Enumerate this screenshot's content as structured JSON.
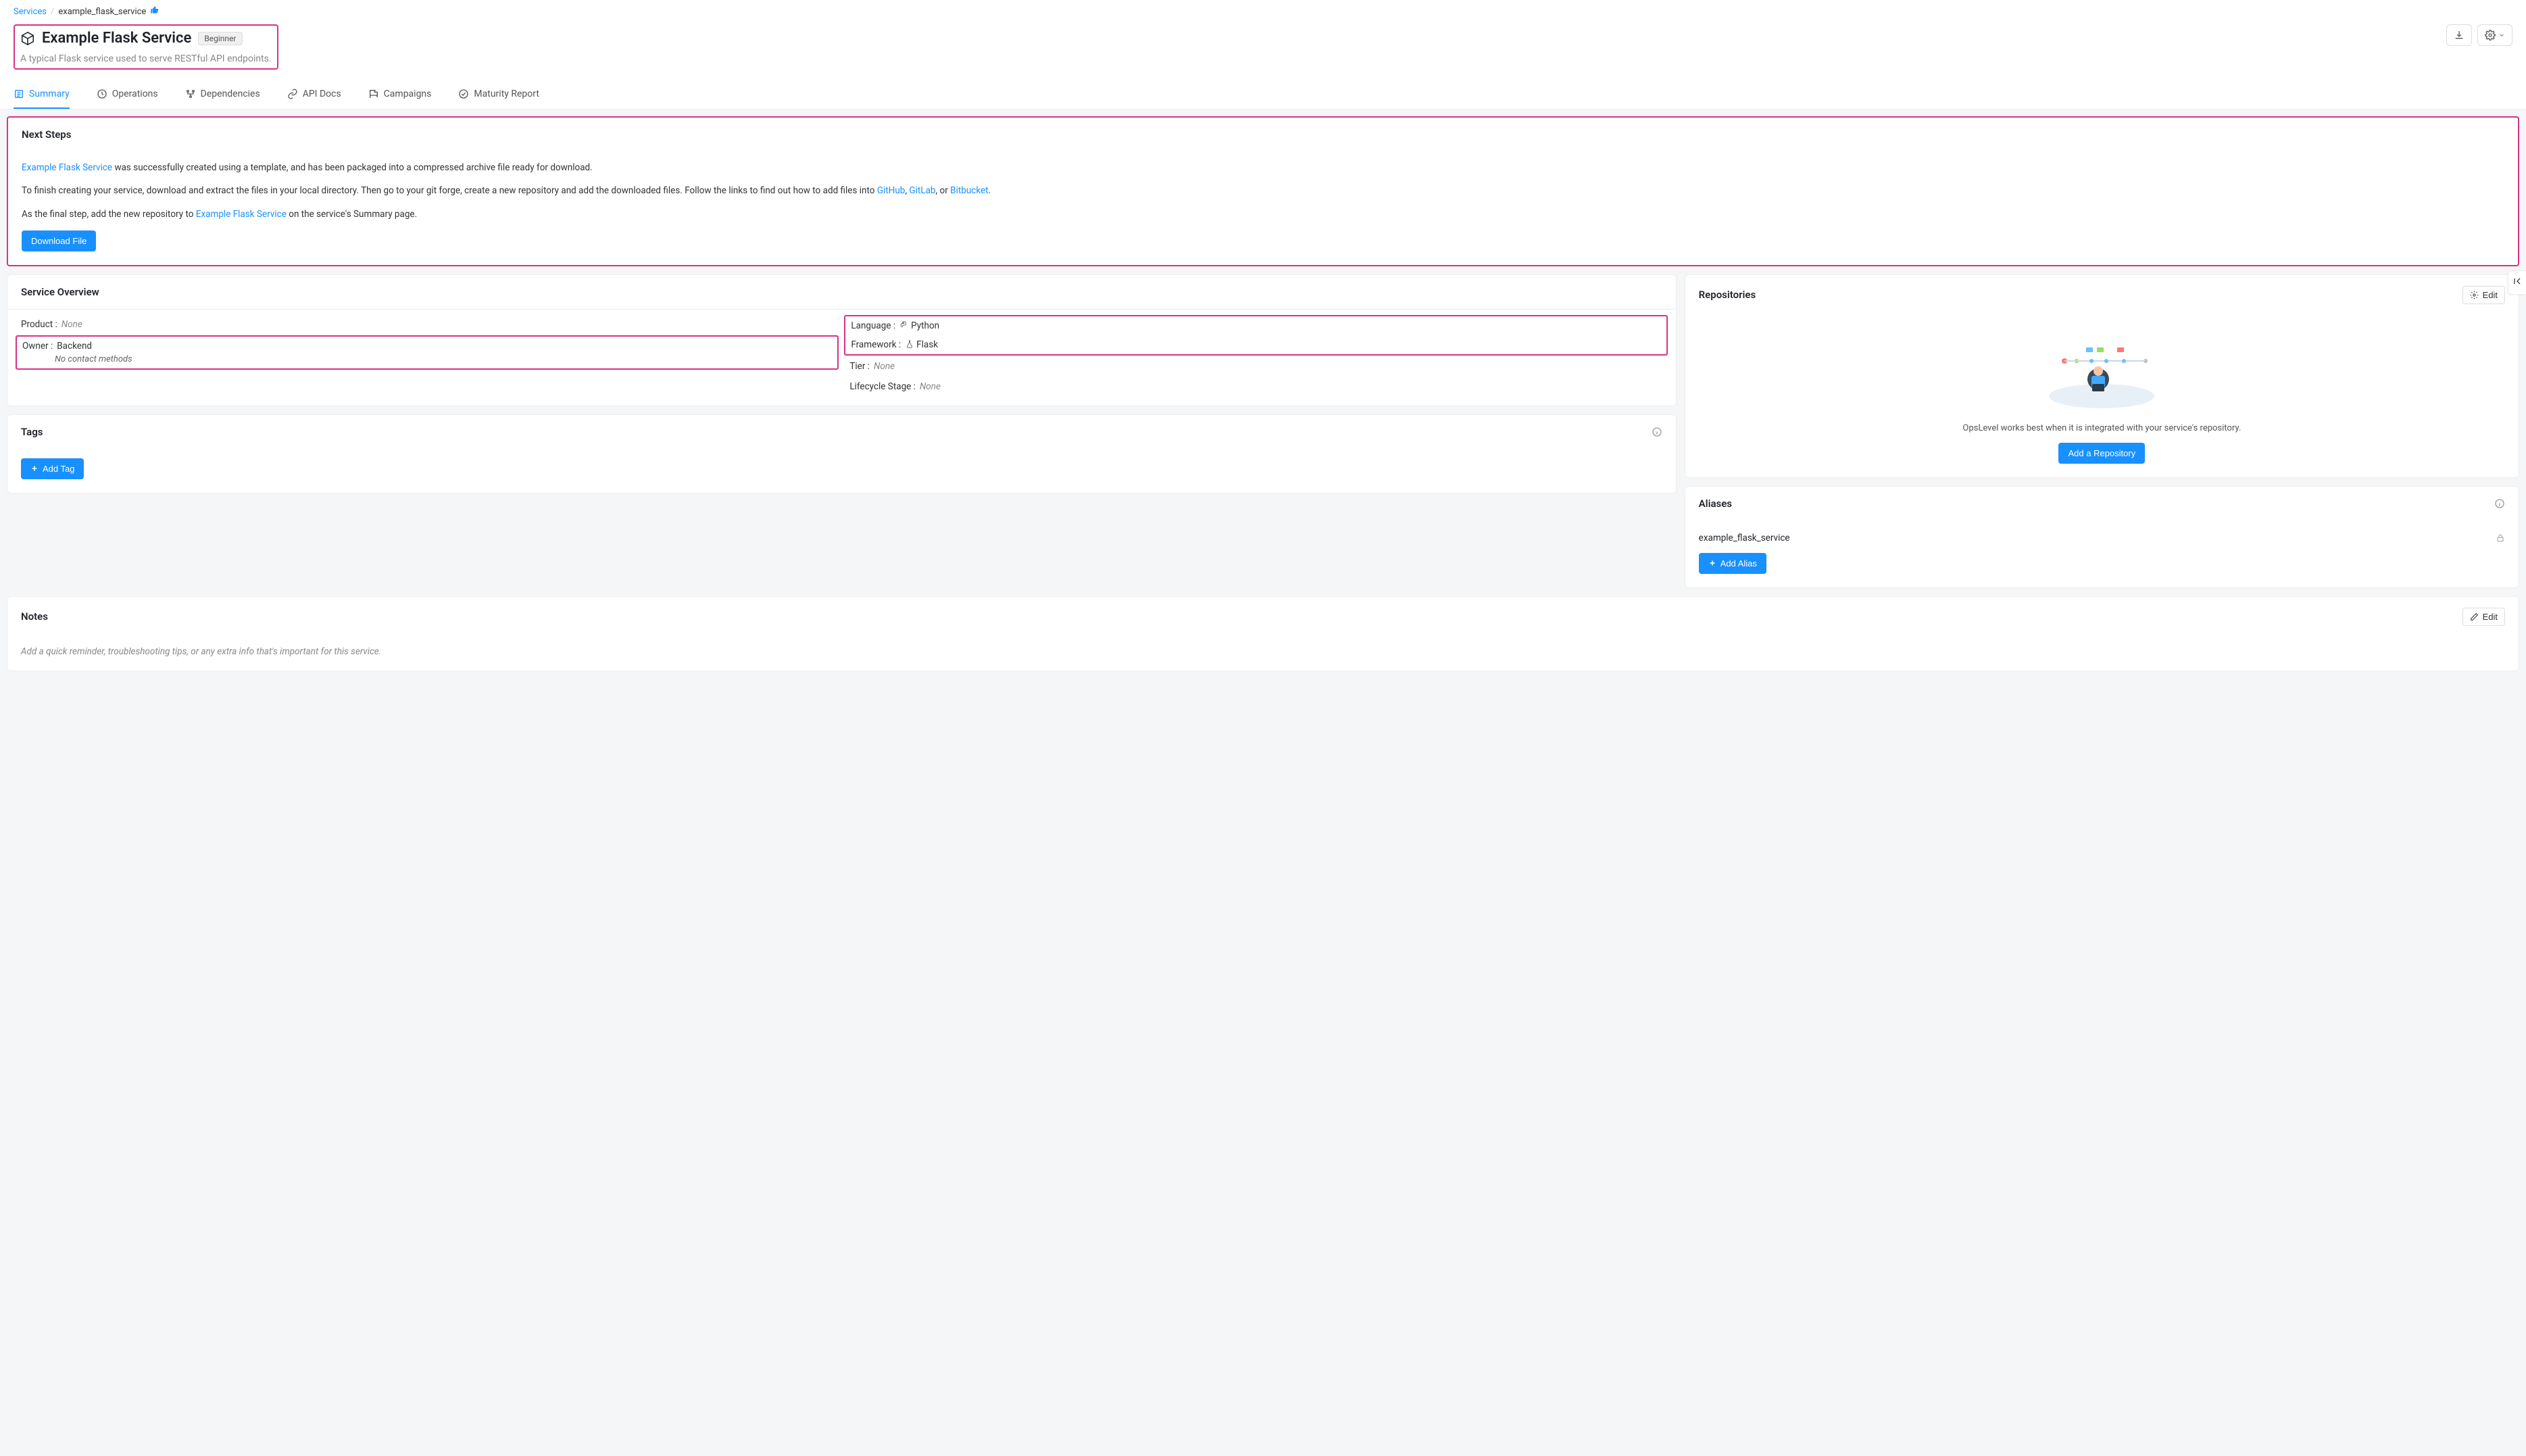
{
  "breadcrumb": {
    "root": "Services",
    "current": "example_flask_service"
  },
  "header": {
    "title": "Example Flask Service",
    "badge": "Beginner",
    "desc": "A typical Flask service used to serve RESTful API endpoints."
  },
  "tabs": [
    {
      "label": "Summary",
      "active": true
    },
    {
      "label": "Operations",
      "active": false
    },
    {
      "label": "Dependencies",
      "active": false
    },
    {
      "label": "API Docs",
      "active": false
    },
    {
      "label": "Campaigns",
      "active": false
    },
    {
      "label": "Maturity Report",
      "active": false
    }
  ],
  "next_steps": {
    "title": "Next Steps",
    "link_name": "Example Flask Service",
    "p1_rest": " was successfully created using a template, and has been packaged into a compressed archive file ready for download.",
    "p2_a": "To finish creating your service, download and extract the files in your local directory. Then go to your git forge, create a new repository and add the downloaded files. Follow the links to find out how to add files into ",
    "github": "GitHub",
    "gitlab": "GitLab",
    "bitbucket": "Bitbucket",
    "or": ", or ",
    "comma": ", ",
    "period": ".",
    "p3_a": "As the final step, add the new repository to ",
    "p3_link": "Example Flask Service",
    "p3_b": " on the service's Summary page.",
    "download_btn": "Download File"
  },
  "overview": {
    "title": "Service Overview",
    "product_label": "Product :",
    "product_value": "None",
    "owner_label": "Owner :",
    "owner_value": "Backend",
    "owner_sub": "No contact methods",
    "language_label": "Language :",
    "language_value": "Python",
    "framework_label": "Framework :",
    "framework_value": "Flask",
    "tier_label": "Tier :",
    "tier_value": "None",
    "lifecycle_label": "Lifecycle Stage :",
    "lifecycle_value": "None"
  },
  "repositories": {
    "title": "Repositories",
    "edit": "Edit",
    "empty_text": "OpsLevel works best when it is integrated with your service's repository.",
    "add_btn": "Add a Repository"
  },
  "tags": {
    "title": "Tags",
    "add_btn": "Add Tag"
  },
  "aliases": {
    "title": "Aliases",
    "items": [
      "example_flask_service"
    ],
    "add_btn": "Add Alias"
  },
  "notes": {
    "title": "Notes",
    "edit": "Edit",
    "placeholder": "Add a quick reminder, troubleshooting tips, or any extra info that's important for this service."
  }
}
